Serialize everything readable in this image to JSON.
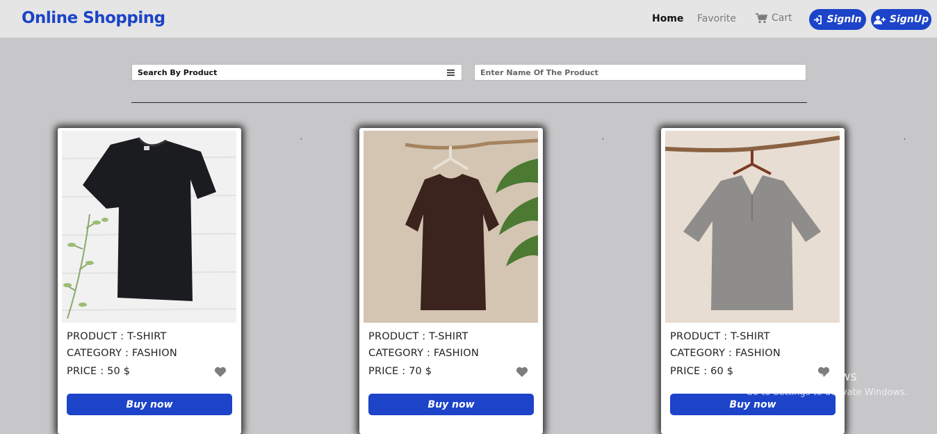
{
  "navbar": {
    "brand": "Online Shopping",
    "links": {
      "home": "Home",
      "favorite": "Favorite",
      "cart": "Cart"
    },
    "signin": "SignIn",
    "signup": "SignUp"
  },
  "search": {
    "select_label": "Search By Product",
    "input_placeholder": "Enter Name Of The Product",
    "input_value": ""
  },
  "products": [
    {
      "product": "PRODUCT : T-SHIRT",
      "category": "CATEGORY : FASHION",
      "price": "PRICE : 50 $",
      "buy": "Buy now",
      "image": "black-tshirt"
    },
    {
      "product": "PRODUCT : T-SHIRT",
      "category": "CATEGORY : FASHION",
      "price": "PRICE : 70 $",
      "buy": "Buy now",
      "image": "brown-tshirt-on-hanger"
    },
    {
      "product": "PRODUCT : T-SHIRT",
      "category": "CATEGORY : FASHION",
      "price": "PRICE : 60 $",
      "buy": "Buy now",
      "image": "grey-shirt-on-hanger"
    }
  ],
  "watermark": {
    "title": "Activate Windows",
    "subtitle": "Go to Settings to activate Windows."
  },
  "colors": {
    "accent": "#1c43c8",
    "background": "#c7c7c9",
    "navbar": "#e5e5e5"
  }
}
